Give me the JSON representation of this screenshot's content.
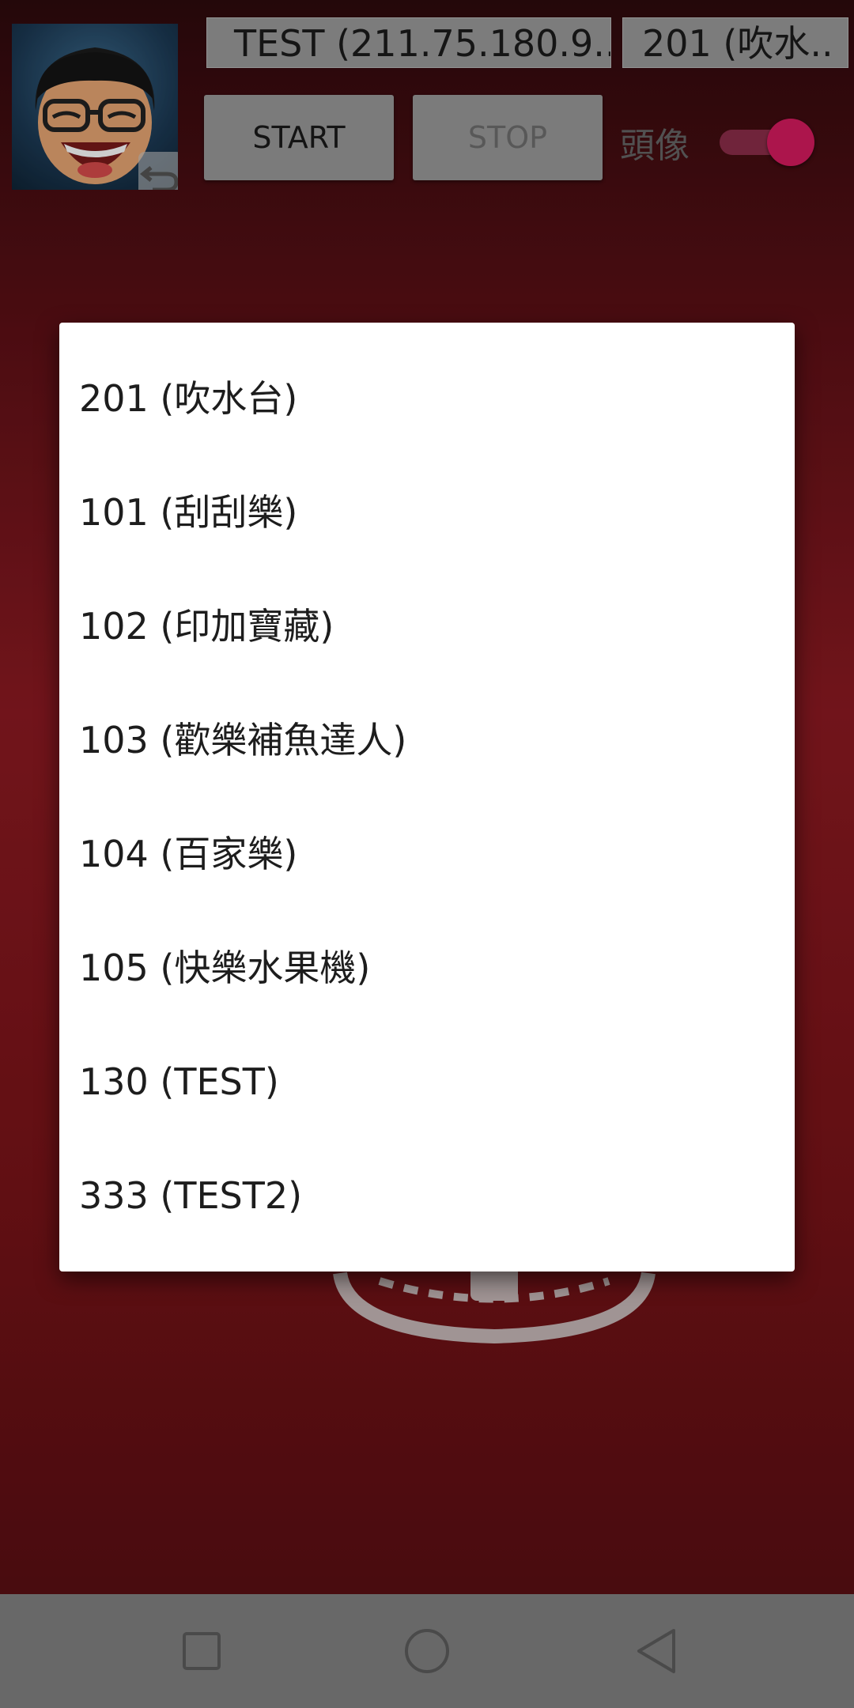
{
  "toolbar": {
    "server_selected": "TEST (211.75.180.9..",
    "game_selected": "201 (吹水..",
    "start_label": "START",
    "stop_label": "STOP",
    "avatar_toggle_label": "頭像",
    "avatar_toggle_on": true
  },
  "dialog": {
    "options": [
      {
        "label": "201 (吹水台)"
      },
      {
        "label": "101 (刮刮樂)"
      },
      {
        "label": "102 (印加寶藏)"
      },
      {
        "label": "103 (歡樂補魚達人)"
      },
      {
        "label": "104 (百家樂)"
      },
      {
        "label": "105 (快樂水果機)"
      },
      {
        "label": "130 (TEST)"
      },
      {
        "label": "333 (TEST2)"
      }
    ]
  },
  "navbar": {
    "icons": [
      "recents-icon",
      "home-icon",
      "back-icon"
    ]
  },
  "colors": {
    "accent": "#d81b60",
    "background_red": "#8e1a22",
    "navbar": "#686868"
  }
}
